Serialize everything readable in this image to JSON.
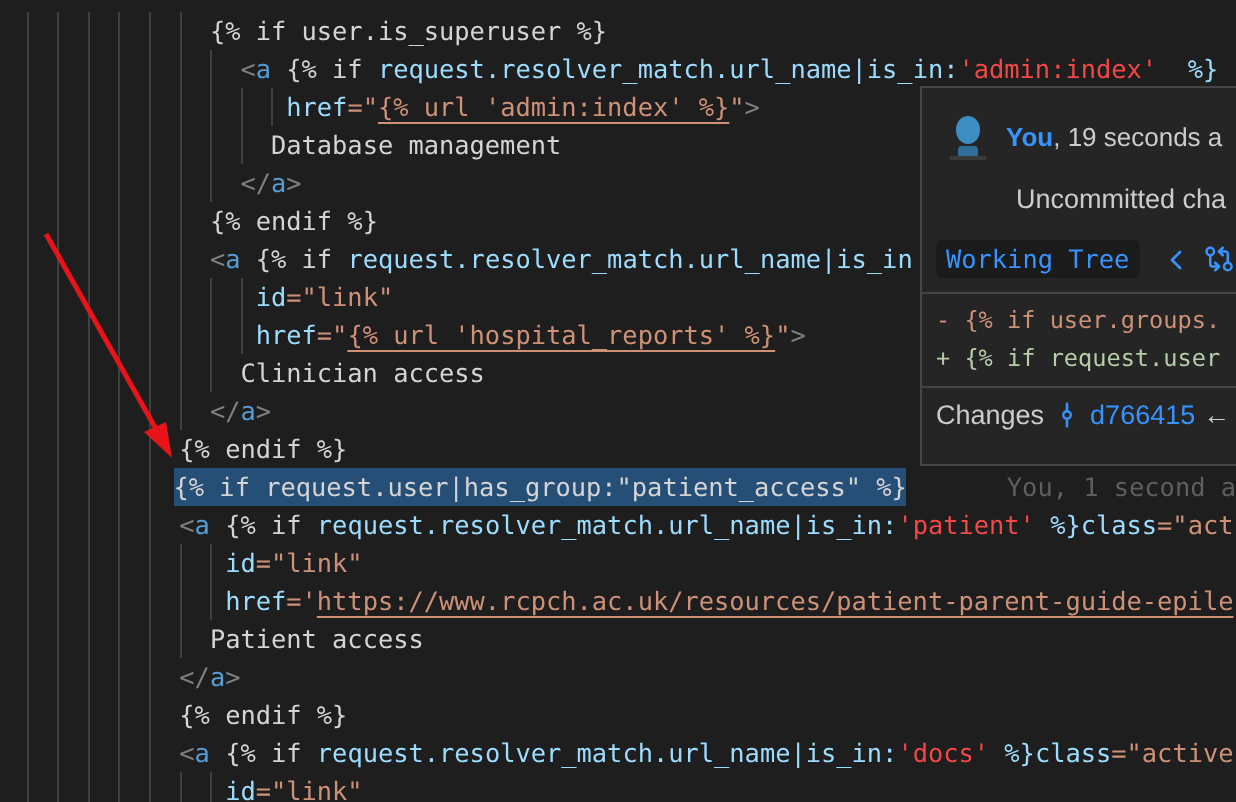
{
  "editor": {
    "lines": [
      {
        "selected": false,
        "segments": [
          {
            "text": "              {% if user.is_superuser %}",
            "kind": "plain"
          }
        ]
      },
      {
        "selected": false,
        "segments": [
          {
            "text": "                <",
            "kind": "punct"
          },
          {
            "text": "a",
            "kind": "tag"
          },
          {
            "text": " {% if ",
            "kind": "plain"
          },
          {
            "text": "request.resolver_match.url_name|is_in:",
            "kind": "attr"
          },
          {
            "text": "'admin:index'",
            "kind": "error"
          },
          {
            "text": "  %}",
            "kind": "attr"
          }
        ]
      },
      {
        "selected": false,
        "segments": [
          {
            "text": "                   href",
            "kind": "attr"
          },
          {
            "text": "=\"",
            "kind": "string"
          },
          {
            "text": "{% url 'admin:index' %}",
            "kind": "link"
          },
          {
            "text": "\"",
            "kind": "string"
          },
          {
            "text": ">",
            "kind": "punct"
          }
        ]
      },
      {
        "selected": false,
        "segments": [
          {
            "text": "                  Database management",
            "kind": "plain"
          }
        ]
      },
      {
        "selected": false,
        "segments": [
          {
            "text": "                </",
            "kind": "punct"
          },
          {
            "text": "a",
            "kind": "tag"
          },
          {
            "text": ">",
            "kind": "punct"
          }
        ]
      },
      {
        "selected": false,
        "segments": [
          {
            "text": "              {% endif %}",
            "kind": "plain"
          }
        ]
      },
      {
        "selected": false,
        "segments": [
          {
            "text": "              <",
            "kind": "punct"
          },
          {
            "text": "a",
            "kind": "tag"
          },
          {
            "text": " {% if ",
            "kind": "plain"
          },
          {
            "text": "request.resolver_match.url_name|is_in",
            "kind": "attr"
          }
        ]
      },
      {
        "selected": false,
        "segments": [
          {
            "text": "                 id",
            "kind": "attr"
          },
          {
            "text": "=\"link\"",
            "kind": "string"
          }
        ]
      },
      {
        "selected": false,
        "segments": [
          {
            "text": "                 href",
            "kind": "attr"
          },
          {
            "text": "=\"",
            "kind": "string"
          },
          {
            "text": "{% url 'hospital_reports' %}",
            "kind": "link"
          },
          {
            "text": "\"",
            "kind": "string"
          },
          {
            "text": ">",
            "kind": "punct"
          }
        ]
      },
      {
        "selected": false,
        "segments": [
          {
            "text": "                Clinician access",
            "kind": "plain"
          }
        ]
      },
      {
        "selected": false,
        "segments": [
          {
            "text": "              </",
            "kind": "punct"
          },
          {
            "text": "a",
            "kind": "tag"
          },
          {
            "text": ">",
            "kind": "punct"
          }
        ]
      },
      {
        "selected": false,
        "segments": [
          {
            "text": "            {% endif %}",
            "kind": "plain"
          }
        ]
      },
      {
        "selected": true,
        "blame": "You, 1 second a",
        "segments": [
          {
            "text": "            {% if request.user|has_group:\"patient_access\" %}",
            "kind": "plain"
          }
        ]
      },
      {
        "selected": false,
        "segments": [
          {
            "text": "            <",
            "kind": "punct"
          },
          {
            "text": "a",
            "kind": "tag"
          },
          {
            "text": " {% if ",
            "kind": "plain"
          },
          {
            "text": "request.resolver_match.url_name|is_in:",
            "kind": "attr"
          },
          {
            "text": "'patient'",
            "kind": "error"
          },
          {
            "text": " %}class",
            "kind": "attr"
          },
          {
            "text": "=\"act",
            "kind": "string"
          }
        ]
      },
      {
        "selected": false,
        "segments": [
          {
            "text": "               id",
            "kind": "attr"
          },
          {
            "text": "=\"link\"",
            "kind": "string"
          }
        ]
      },
      {
        "selected": false,
        "segments": [
          {
            "text": "               href",
            "kind": "attr"
          },
          {
            "text": "='",
            "kind": "string"
          },
          {
            "text": "https://www.rcpch.ac.uk/resources/patient-parent-guide-epile",
            "kind": "link"
          }
        ]
      },
      {
        "selected": false,
        "segments": [
          {
            "text": "              Patient access",
            "kind": "plain"
          }
        ]
      },
      {
        "selected": false,
        "segments": [
          {
            "text": "            </",
            "kind": "punct"
          },
          {
            "text": "a",
            "kind": "tag"
          },
          {
            "text": ">",
            "kind": "punct"
          }
        ]
      },
      {
        "selected": false,
        "segments": [
          {
            "text": "            {% endif %}",
            "kind": "plain"
          }
        ]
      },
      {
        "selected": false,
        "segments": [
          {
            "text": "            <",
            "kind": "punct"
          },
          {
            "text": "a",
            "kind": "tag"
          },
          {
            "text": " {% if ",
            "kind": "plain"
          },
          {
            "text": "request.resolver_match.url_name|is_in:",
            "kind": "attr"
          },
          {
            "text": "'docs'",
            "kind": "error"
          },
          {
            "text": " %}class",
            "kind": "attr"
          },
          {
            "text": "=\"active",
            "kind": "string"
          }
        ]
      },
      {
        "selected": false,
        "segments": [
          {
            "text": "               id",
            "kind": "attr"
          },
          {
            "text": "=\"link\"",
            "kind": "string"
          }
        ]
      }
    ]
  },
  "hover": {
    "author": "You",
    "detail": ", 19 seconds a",
    "message": "Uncommitted cha",
    "badge": "Working Tree",
    "diff": [
      {
        "kind": "removed",
        "text": "- {% if user.groups."
      },
      {
        "kind": "added",
        "text": "+ {% if request.user"
      }
    ],
    "changes_label": "Changes",
    "commit": "d766415",
    "arrow": "←"
  }
}
